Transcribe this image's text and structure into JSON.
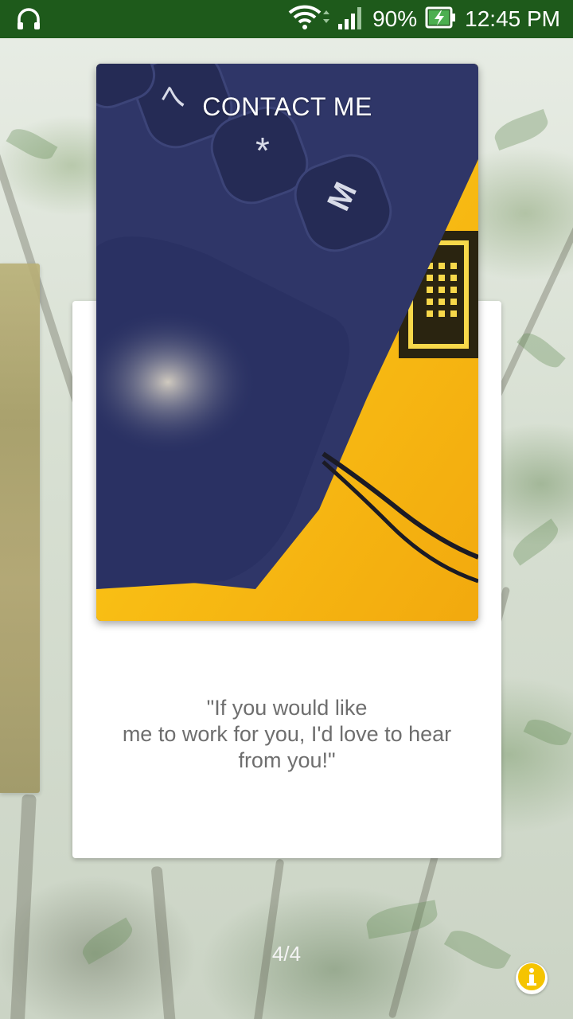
{
  "status_bar": {
    "battery_percent": "90%",
    "time": "12:45 PM",
    "left_icon": "headphones-icon",
    "icons": [
      "wifi-icon",
      "signal-icon",
      "battery-charging-icon"
    ]
  },
  "card": {
    "title": "CONTACT ME",
    "quote": "\"If you would like\nme to work for you, I'd love to hear\nfrom you!\""
  },
  "pager": {
    "text": "4/4"
  },
  "info_button": {
    "icon": "info-icon"
  },
  "colors": {
    "status_bar_bg": "#1e5a1b",
    "info_accent": "#f5c400",
    "quote_text": "#6e6e6e"
  }
}
